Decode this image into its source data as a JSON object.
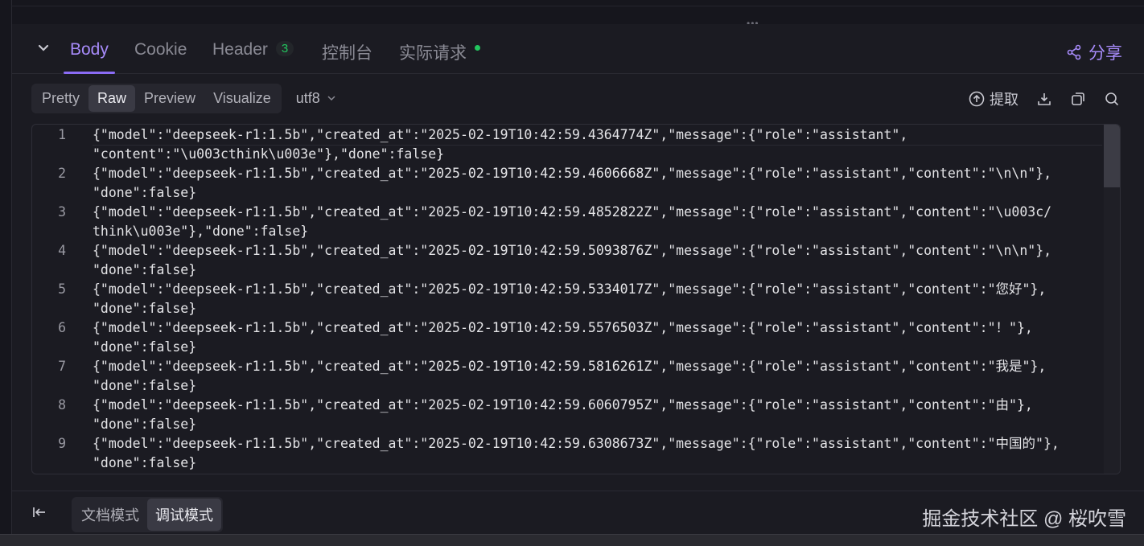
{
  "tabs": {
    "body": "Body",
    "cookie": "Cookie",
    "header": "Header",
    "header_count": "3",
    "console": "控制台",
    "actual_request": "实际请求",
    "share": "分享"
  },
  "view_modes": [
    "Pretty",
    "Raw",
    "Preview",
    "Visualize"
  ],
  "active_view_mode": "Raw",
  "encoding": "utf8",
  "actions": {
    "extract": "提取"
  },
  "code_lines": [
    {
      "n": "1",
      "text": "{\"model\":\"deepseek-r1:1.5b\",\"created_at\":\"2025-02-19T10:42:59.4364774Z\",\"message\":{\"role\":\"assistant\",",
      "wrap": "\"content\":\"\\u003cthink\\u003e\"},\"done\":false}"
    },
    {
      "n": "2",
      "text": "{\"model\":\"deepseek-r1:1.5b\",\"created_at\":\"2025-02-19T10:42:59.4606668Z\",\"message\":{\"role\":\"assistant\",\"content\":\"\\n\\n\"},",
      "wrap": "\"done\":false}"
    },
    {
      "n": "3",
      "text": "{\"model\":\"deepseek-r1:1.5b\",\"created_at\":\"2025-02-19T10:42:59.4852822Z\",\"message\":{\"role\":\"assistant\",\"content\":\"\\u003c/",
      "wrap": "think\\u003e\"},\"done\":false}"
    },
    {
      "n": "4",
      "text": "{\"model\":\"deepseek-r1:1.5b\",\"created_at\":\"2025-02-19T10:42:59.5093876Z\",\"message\":{\"role\":\"assistant\",\"content\":\"\\n\\n\"},",
      "wrap": "\"done\":false}"
    },
    {
      "n": "5",
      "text": "{\"model\":\"deepseek-r1:1.5b\",\"created_at\":\"2025-02-19T10:42:59.5334017Z\",\"message\":{\"role\":\"assistant\",\"content\":\"您好\"},",
      "wrap": "\"done\":false}"
    },
    {
      "n": "6",
      "text": "{\"model\":\"deepseek-r1:1.5b\",\"created_at\":\"2025-02-19T10:42:59.5576503Z\",\"message\":{\"role\":\"assistant\",\"content\":\"！\"},",
      "wrap": "\"done\":false}"
    },
    {
      "n": "7",
      "text": "{\"model\":\"deepseek-r1:1.5b\",\"created_at\":\"2025-02-19T10:42:59.5816261Z\",\"message\":{\"role\":\"assistant\",\"content\":\"我是\"},",
      "wrap": "\"done\":false}"
    },
    {
      "n": "8",
      "text": "{\"model\":\"deepseek-r1:1.5b\",\"created_at\":\"2025-02-19T10:42:59.6060795Z\",\"message\":{\"role\":\"assistant\",\"content\":\"由\"},",
      "wrap": "\"done\":false}"
    },
    {
      "n": "9",
      "text": "{\"model\":\"deepseek-r1:1.5b\",\"created_at\":\"2025-02-19T10:42:59.6308673Z\",\"message\":{\"role\":\"assistant\",\"content\":\"中国的\"},",
      "wrap": "\"done\":false}"
    }
  ],
  "footer": {
    "doc_mode": "文档模式",
    "debug_mode": "调试模式",
    "watermark": "掘金技术社区 @ 桜吹雪"
  },
  "colors": {
    "accent": "#a78bfa",
    "status_ok": "#22c55e",
    "background": "#1b1b22"
  },
  "icons": [
    "chevron-down-icon",
    "share-icon",
    "upload-icon",
    "download-icon",
    "copy-icon",
    "search-icon",
    "collapse-left-icon"
  ]
}
